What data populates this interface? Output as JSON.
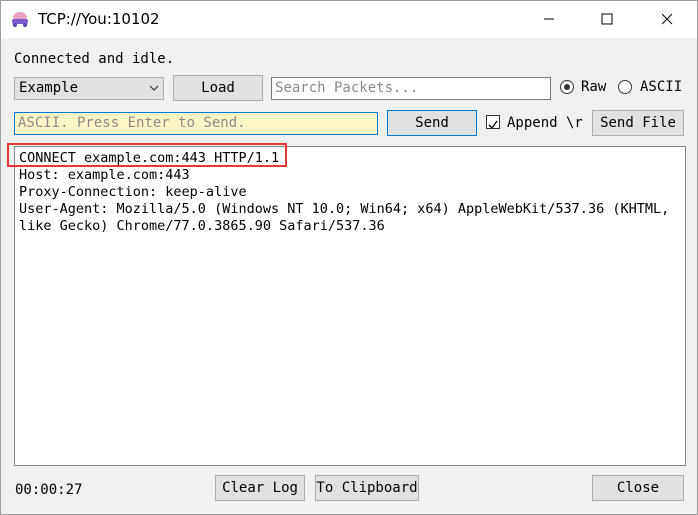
{
  "window": {
    "title": "TCP://You:10102"
  },
  "status_text": "Connected and idle.",
  "toolbar": {
    "profile_select": "Example",
    "load_label": "Load",
    "search_placeholder": "Search Packets...",
    "raw_label": "Raw",
    "ascii_label": "ASCII",
    "mode_selected": "Raw"
  },
  "send_row": {
    "input_placeholder": "ASCII. Press Enter to Send.",
    "send_label": "Send",
    "append_label": "Append \\r",
    "append_checked": true,
    "send_file_label": "Send File"
  },
  "log": {
    "lines": [
      "CONNECT example.com:443 HTTP/1.1",
      "Host: example.com:443",
      "Proxy-Connection: keep-alive",
      "User-Agent: Mozilla/5.0 (Windows NT 10.0; Win64; x64) AppleWebKit/537.36 (KHTML,",
      "like Gecko) Chrome/77.0.3865.90 Safari/537.36"
    ]
  },
  "footer": {
    "timer": "00:00:27",
    "clear_log_label": "Clear Log",
    "clipboard_label": "To Clipboard",
    "close_label": "Close"
  },
  "colors": {
    "accent": "#0078d7",
    "highlight": "#e53935",
    "send_input_bg": "#fff4c4"
  }
}
